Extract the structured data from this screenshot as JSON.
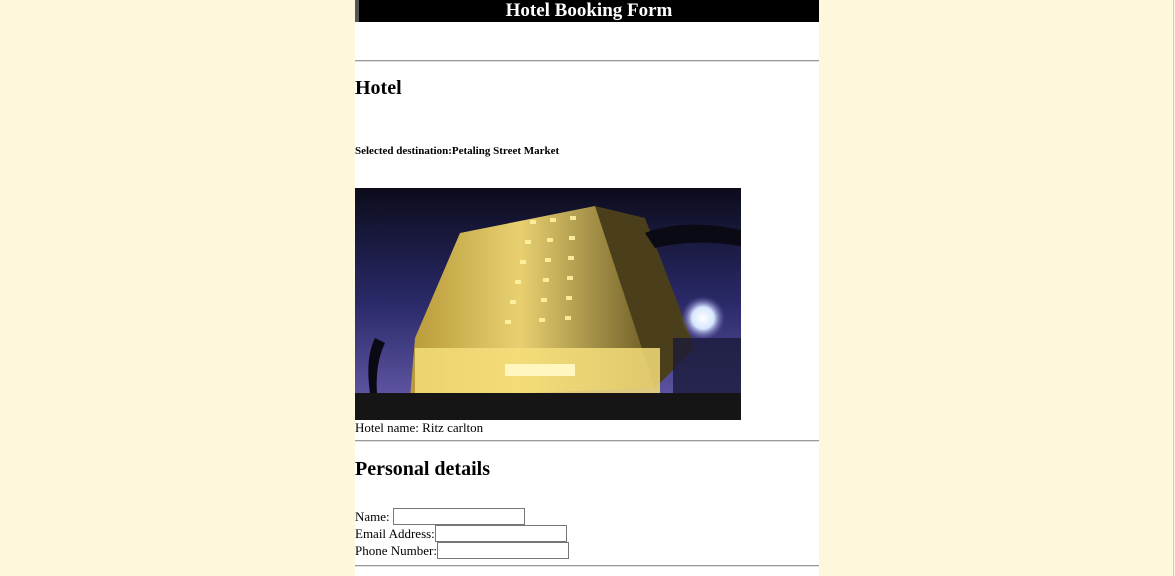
{
  "header": {
    "title": "Hotel Booking Form"
  },
  "hotel_section": {
    "title": "Hotel",
    "destination_label": "Selected destination:",
    "destination_value": "Petaling Street Market",
    "hotel_name_label": "Hotel name:",
    "hotel_name_value": "Ritz carlton"
  },
  "personal_section": {
    "title": "Personal details",
    "name_label": "Name:",
    "name_value": "",
    "email_label": "Email Address:",
    "email_value": "",
    "phone_label": "Phone Number:",
    "phone_value": ""
  },
  "colors": {
    "page_background": "#fff7dc",
    "content_background": "#ffffff",
    "title_bar": "#000000"
  }
}
